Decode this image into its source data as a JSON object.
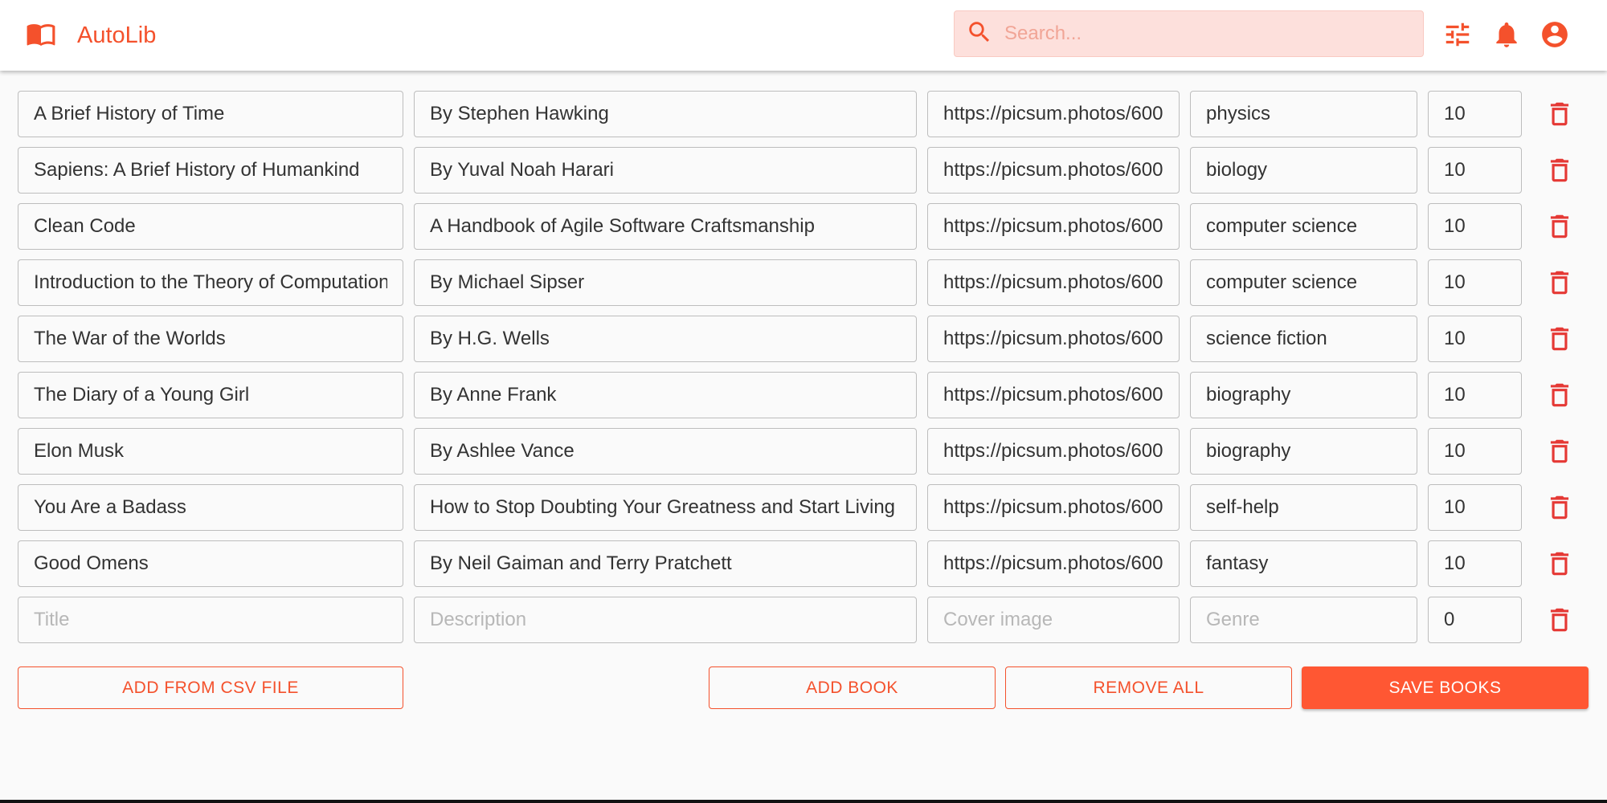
{
  "app": {
    "name": "AutoLib",
    "accent_color": "#f4512c",
    "logo_icon": "open-book-icon"
  },
  "search": {
    "placeholder": "Search...",
    "value": ""
  },
  "toolbar_icons": [
    "tune-icon",
    "bell-icon",
    "account-circle-icon"
  ],
  "placeholders": {
    "title": "Title",
    "description": "Description",
    "cover": "Cover image",
    "genre": "Genre"
  },
  "books": [
    {
      "title": "A Brief History of Time",
      "description": "By Stephen Hawking",
      "cover": "https://picsum.photos/600.",
      "genre": "physics",
      "quantity": "10"
    },
    {
      "title": "Sapiens: A Brief History of Humankind",
      "description": "By Yuval Noah Harari",
      "cover": "https://picsum.photos/600.",
      "genre": "biology",
      "quantity": "10"
    },
    {
      "title": "Clean Code",
      "description": "A Handbook of Agile Software Craftsmanship",
      "cover": "https://picsum.photos/600.",
      "genre": "computer science",
      "quantity": "10"
    },
    {
      "title": "Introduction to the Theory of Computation",
      "description": "By Michael Sipser",
      "cover": "https://picsum.photos/600.",
      "genre": "computer science",
      "quantity": "10"
    },
    {
      "title": "The War of the Worlds",
      "description": "By H.G. Wells",
      "cover": "https://picsum.photos/600.",
      "genre": "science fiction",
      "quantity": "10"
    },
    {
      "title": "The Diary of a Young Girl",
      "description": "By Anne Frank",
      "cover": "https://picsum.photos/600.",
      "genre": "biography",
      "quantity": "10"
    },
    {
      "title": "Elon Musk",
      "description": "By Ashlee Vance",
      "cover": "https://picsum.photos/600.",
      "genre": "biography",
      "quantity": "10"
    },
    {
      "title": "You Are a Badass",
      "description": "How to Stop Doubting Your Greatness and Start Living a",
      "cover": "https://picsum.photos/600.",
      "genre": "self-help",
      "quantity": "10"
    },
    {
      "title": "Good Omens",
      "description": "By Neil Gaiman and Terry Pratchett",
      "cover": "https://picsum.photos/600.",
      "genre": "fantasy",
      "quantity": "10"
    },
    {
      "title": "",
      "description": "",
      "cover": "",
      "genre": "",
      "quantity": "0"
    }
  ],
  "actions": {
    "add_csv": "ADD FROM CSV FILE",
    "add_book": "ADD BOOK",
    "remove_all": "REMOVE ALL",
    "save_books": "SAVE BOOKS"
  }
}
